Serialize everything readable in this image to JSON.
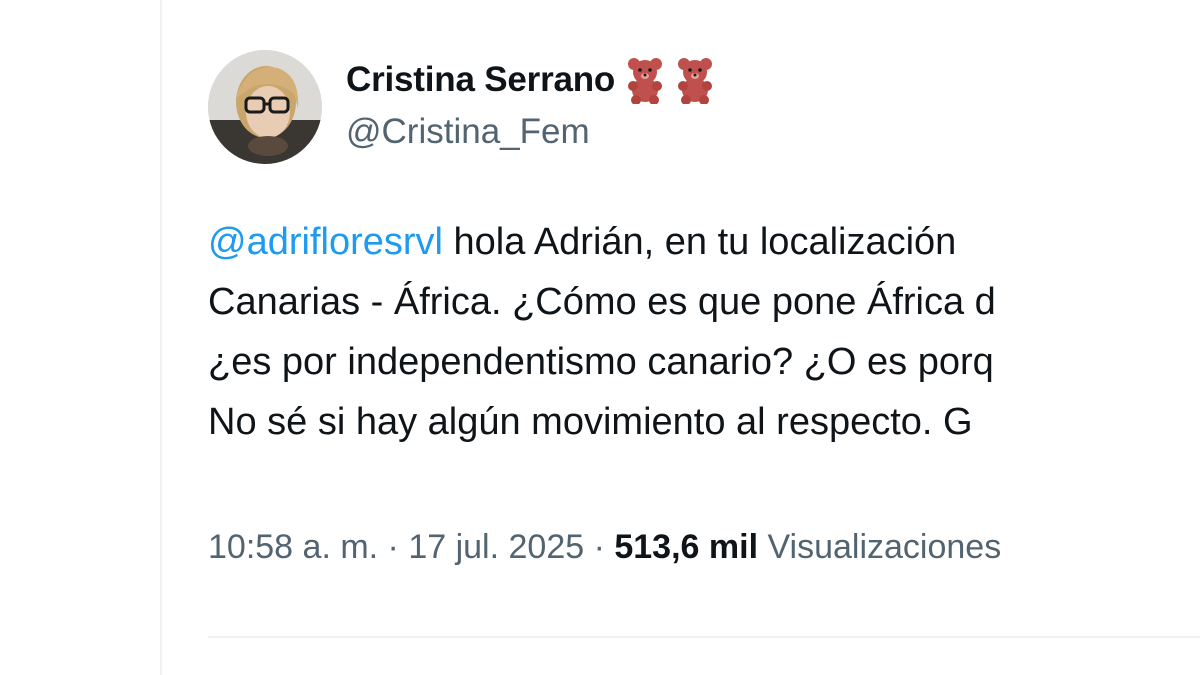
{
  "tweet": {
    "author": {
      "display_name": "Cristina Serrano",
      "handle": "@Cristina_Fem",
      "name_emojis": [
        "teddy-bear-icon",
        "teddy-bear-icon"
      ]
    },
    "text_lines": [
      {
        "mention": "@adrifloresrvl",
        "rest": " hola Adrián, en tu localización"
      },
      {
        "mention": "",
        "rest": "Canarias - África. ¿Cómo es que pone África d"
      },
      {
        "mention": "",
        "rest": "¿es por independentismo canario? ¿O es porq"
      },
      {
        "mention": "",
        "rest": "No sé si hay algún movimiento al respecto. G"
      }
    ],
    "meta": {
      "time": "10:58 a. m.",
      "separator": " · ",
      "date": "17 jul. 2025",
      "views_count": "513,6 mil",
      "views_label": " Visualizaciones"
    },
    "colors": {
      "mention": "#1d9bf0",
      "secondary": "#536471",
      "primary": "#0f1419",
      "bear": "#c0504d"
    }
  }
}
